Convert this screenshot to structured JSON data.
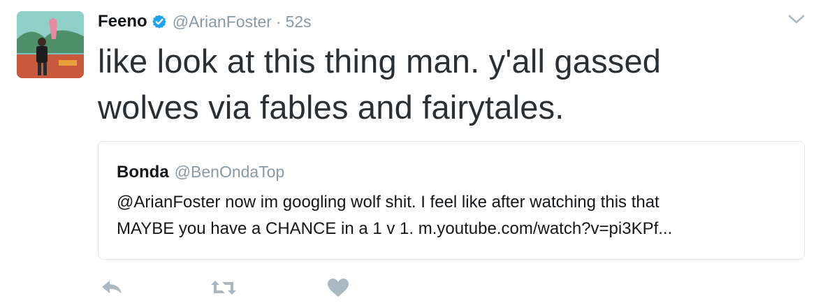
{
  "tweet": {
    "display_name": "Feeno",
    "verified_icon": "verified-badge-icon",
    "handle": "@ArianFoster",
    "separator": "·",
    "timestamp": "52s",
    "text_line1": "like look at this thing man. y'all gassed",
    "text_line2": "wolves via fables and fairytales."
  },
  "quoted_tweet": {
    "display_name": "Bonda",
    "handle": "@BenOndaTop",
    "text_line1": "@ArianFoster now im googling wolf shit. I feel like after watching this that",
    "text_line2": "MAYBE you have a CHANCE in a 1 v 1. m.youtube.com/watch?v=pi3KPf..."
  },
  "actions": [
    {
      "name": "reply",
      "icon": "reply-icon"
    },
    {
      "name": "retweet",
      "icon": "retweet-icon"
    },
    {
      "name": "like",
      "icon": "heart-icon"
    }
  ],
  "colors": {
    "text": "#14171a",
    "secondary": "#8899a6",
    "verified": "#1da1f2",
    "border": "#e1e8ed",
    "action": "#aab8c2"
  }
}
